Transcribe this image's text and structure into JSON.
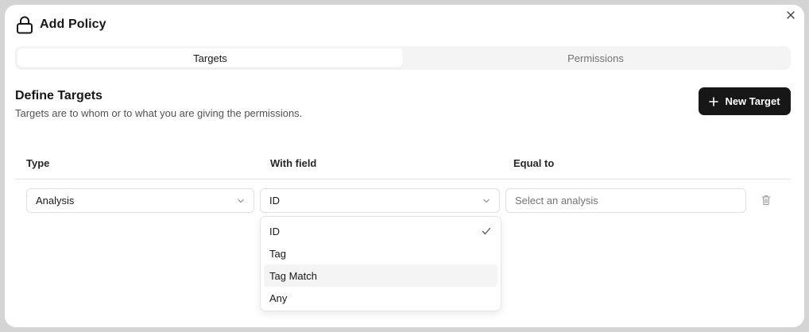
{
  "dialog": {
    "title": "Add Policy",
    "title_icon": "lock-icon",
    "close_icon": "close-icon"
  },
  "tabs": [
    {
      "label": "Targets",
      "active": true
    },
    {
      "label": "Permissions",
      "active": false
    }
  ],
  "section": {
    "title": "Define Targets",
    "description": "Targets are to whom or to what you are giving the permissions."
  },
  "new_target_button": {
    "label": "New Target",
    "icon": "plus-icon"
  },
  "table": {
    "headers": [
      "Type",
      "With field",
      "Equal to"
    ],
    "row": {
      "type": "Analysis",
      "field": "ID",
      "value_placeholder": "Select an analysis",
      "delete_icon": "trash-icon"
    }
  },
  "field_dropdown": {
    "options": [
      "ID",
      "Tag",
      "Tag Match",
      "Any"
    ],
    "selected": "ID",
    "highlighted": "Tag Match"
  },
  "colors": {
    "primary_button_bg": "#171717",
    "tab_track_bg": "#f4f4f4",
    "muted_text": "#737373",
    "border": "#e0e0e0"
  }
}
